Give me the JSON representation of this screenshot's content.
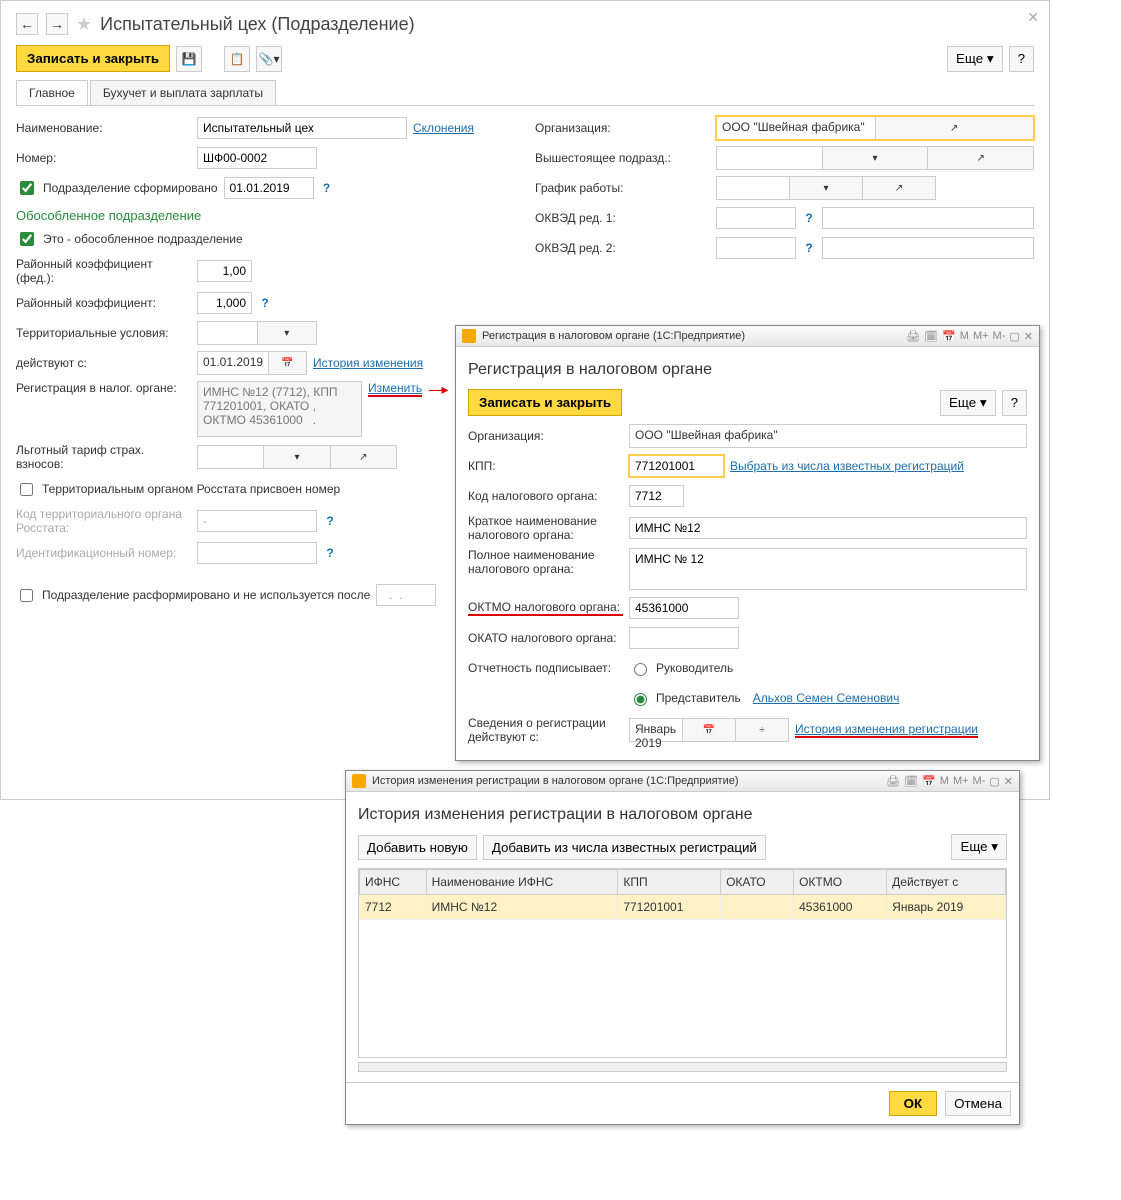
{
  "main": {
    "title": "Испытательный цех (Подразделение)",
    "save_close": "Записать и закрыть",
    "more": "Еще",
    "tabs": {
      "tab1": "Главное",
      "tab2": "Бухучет и выплата зарплаты"
    },
    "left": {
      "name_lbl": "Наименование:",
      "name_val": "Испытательный цех",
      "decl": "Склонения",
      "num_lbl": "Номер:",
      "num_val": "ШФ00-0002",
      "formed_cb": "Подразделение сформировано",
      "formed_date": "01.01.2019",
      "sep_h": "Обособленное подразделение",
      "sep_cb": "Это - обособленное подразделение",
      "rk_fed_lbl": "Районный коэффициент (фед.):",
      "rk_fed_val": "1,00",
      "rk_lbl": "Районный коэффициент:",
      "rk_val": "1,000",
      "terr_lbl": "Территориальные условия:",
      "from_lbl": "действуют с:",
      "from_val": "01.01.2019",
      "hist_lnk": "История изменения",
      "reg_lbl": "Регистрация в налог. органе:",
      "reg_val": "ИМНС №12 (7712), КПП 771201001, ОКАТО , ОКТМО 45361000   .",
      "change_lnk": "Изменить",
      "tariff_lbl": "Льготный тариф страх. взносов:",
      "rosstat_cb": "Территориальным органом Росстата присвоен номер",
      "rosstat_code_lbl": "Код территориального органа Росстата:",
      "rosstat_code_val": "-",
      "id_lbl": "Идентификационный номер:",
      "disband_cb": "Подразделение расформировано и не используется после",
      "disband_val": "  .  .    "
    },
    "right": {
      "org_lbl": "Организация:",
      "org_val": "ООО \"Швейная фабрика\"",
      "parent_lbl": "Вышестоящее подразд.:",
      "sched_lbl": "График работы:",
      "okved1_lbl": "ОКВЭД ред. 1:",
      "okved2_lbl": "ОКВЭД ред. 2:"
    }
  },
  "reg_popup": {
    "winbar": "Регистрация в налоговом органе  (1С:Предприятие)",
    "title": "Регистрация в налоговом органе",
    "save_close": "Записать и закрыть",
    "more": "Еще",
    "org_lbl": "Организация:",
    "org_val": "ООО \"Швейная фабрика\"",
    "kpp_lbl": "КПП:",
    "kpp_val": "771201001",
    "kpp_lnk": "Выбрать из числа известных регистраций",
    "code_lbl": "Код налогового органа:",
    "code_val": "7712",
    "short_lbl": "Краткое наименование налогового органа:",
    "short_val": "ИМНС №12",
    "full_lbl": "Полное наименование налогового органа:",
    "full_val": "ИМНС № 12",
    "oktmo_lbl": "ОКТМО налогового органа:",
    "oktmo_val": "45361000",
    "okato_lbl": "ОКАТО налогового органа:",
    "sign_lbl": "Отчетность подписывает:",
    "sign_r1": "Руководитель",
    "sign_r2": "Представитель",
    "rep_lnk": "Альхов Семен Семенович",
    "valid_lbl": "Сведения о регистрации действуют с:",
    "valid_val": "Январь 2019",
    "valid_lnk": "История изменения регистрации"
  },
  "hist_popup": {
    "winbar": "История изменения регистрации в налоговом органе  (1С:Предприятие)",
    "title": "История изменения регистрации в налоговом органе",
    "add_new": "Добавить новую",
    "add_known": "Добавить из числа известных регистраций",
    "more": "Еще",
    "cols": {
      "c1": "ИФНС",
      "c2": "Наименование ИФНС",
      "c3": "КПП",
      "c4": "ОКАТО",
      "c5": "ОКТМО",
      "c6": "Действует с"
    },
    "row": {
      "c1": "7712",
      "c2": "ИМНС №12",
      "c3": "771201001",
      "c4": "",
      "c5": "45361000",
      "c6": "Январь 2019"
    },
    "ok": "ОК",
    "cancel": "Отмена"
  },
  "tools": {
    "m": "M",
    "mp": "M+",
    "mm": "M-"
  }
}
